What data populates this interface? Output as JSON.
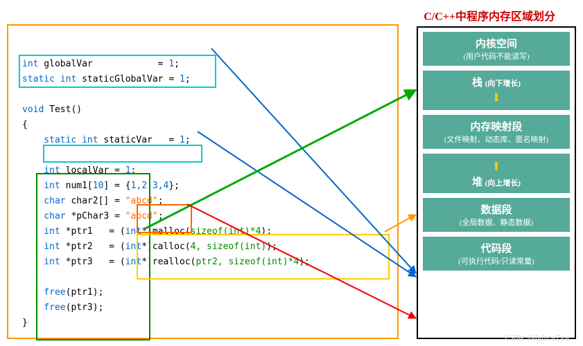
{
  "title": "C/C++中程序内存区域划分",
  "code": {
    "l1a": "int",
    "l1b": " globalVar            = ",
    "l1c": "1",
    "l1d": ";",
    "l2a": "static int",
    "l2b": " staticGlobalVar = ",
    "l2c": "1",
    "l2d": ";",
    "l4a": "void",
    "l4b": " Test()",
    "l5": "{",
    "l6a": "    static int",
    "l6b": " staticVar   = ",
    "l6c": "1",
    "l6d": ";",
    "l8a": "    int",
    "l8b": " localVar = ",
    "l8c": "1",
    "l8d": ";",
    "l9a": "    int",
    "l9b": " num1[",
    "l9c": "10",
    "l9d": "] = {",
    "l9e": "1,2,3,4",
    "l9f": "};",
    "l10a": "    char",
    "l10b": " char2[] = ",
    "l10c": "\"abcd\"",
    "l10d": ";",
    "l11a": "    char",
    "l11b": " *pChar3 = ",
    "l11c": "\"abcd\"",
    "l11d": ";",
    "l12a": "    int",
    "l12b": " *ptr1   = (",
    "l12c": "int",
    "l12d": "*)malloc(",
    "l12e": "sizeof(int)*4",
    "l12f": ");",
    "l13a": "    int",
    "l13b": " *ptr2   = (",
    "l13c": "int",
    "l13d": "*)calloc(",
    "l13e": "4, sizeof(int)",
    "l13f": ");",
    "l14a": "    int",
    "l14b": " *ptr3   = (",
    "l14c": "int",
    "l14d": "*)realloc(",
    "l14e": "ptr2, sizeof(int)*4",
    "l14f": ");",
    "l16a": "    free",
    "l16b": "(ptr1);",
    "l17a": "    free",
    "l17b": "(ptr3);",
    "l18": "}"
  },
  "memory": {
    "b1t": "内核空间",
    "b1s": "(用户代码不能读写)",
    "b2t": "栈 ",
    "b2s": "(向下增长)",
    "b3t": "内存映射段",
    "b3s": "(文件映射、动态库、匿名映射)",
    "b4t": "堆 ",
    "b4s": "(向上增长)",
    "b5t": "数据段",
    "b5s": "(全局数据、静态数据)",
    "b6t": "代码段",
    "b6s": "(可执行代码/只读常量)"
  },
  "watermark": "CSDN @HyDraZya"
}
